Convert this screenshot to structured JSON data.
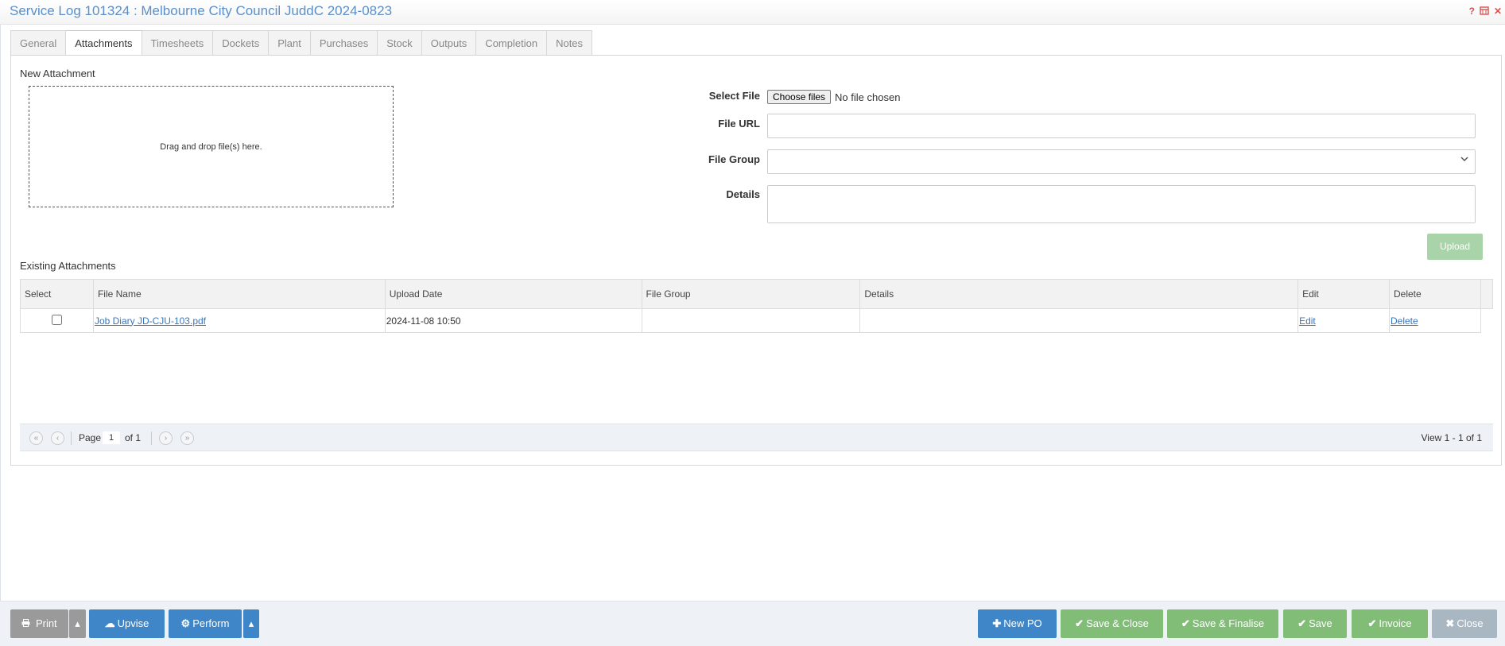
{
  "window": {
    "title": "Service Log 101324 : Melbourne City Council JuddC 2024-0823",
    "icons": [
      "help-icon",
      "calendar-icon",
      "close-icon"
    ]
  },
  "tabs": [
    {
      "label": "General"
    },
    {
      "label": "Attachments",
      "active": true
    },
    {
      "label": "Timesheets"
    },
    {
      "label": "Dockets"
    },
    {
      "label": "Plant"
    },
    {
      "label": "Purchases"
    },
    {
      "label": "Stock"
    },
    {
      "label": "Outputs"
    },
    {
      "label": "Completion"
    },
    {
      "label": "Notes"
    }
  ],
  "new_attachment": {
    "section_title": "New Attachment",
    "dropzone_text": "Drag and drop file(s) here.",
    "select_file_label": "Select File",
    "choose_button": "Choose files",
    "no_file_text": "No file chosen",
    "file_url_label": "File URL",
    "file_url_value": "",
    "file_group_label": "File Group",
    "file_group_value": "",
    "details_label": "Details",
    "details_value": "",
    "upload_button": "Upload"
  },
  "existing_attachments": {
    "section_title": "Existing Attachments",
    "columns": [
      "Select",
      "File Name",
      "Upload Date",
      "File Group",
      "Details",
      "Edit",
      "Delete"
    ],
    "rows": [
      {
        "selected": false,
        "file_name": "Job Diary JD-CJU-103.pdf",
        "upload_date": "2024-11-08 10:50",
        "file_group": "",
        "details": "",
        "edit": "Edit",
        "delete": "Delete"
      }
    ]
  },
  "pager": {
    "page_label": "Page",
    "page_value": "1",
    "of_label": "of 1",
    "view_text": "View 1 - 1 of 1"
  },
  "footer": {
    "print": "Print",
    "upvise": "Upvise",
    "perform": "Perform",
    "new_po": "New PO",
    "save_close": "Save & Close",
    "save_finalise": "Save & Finalise",
    "save": "Save",
    "invoice": "Invoice",
    "close": "Close",
    "colors": {
      "gray": "#9a9a9a",
      "blue": "#3f86c9",
      "green": "#82bd78",
      "close": "#a8b7c2"
    }
  }
}
